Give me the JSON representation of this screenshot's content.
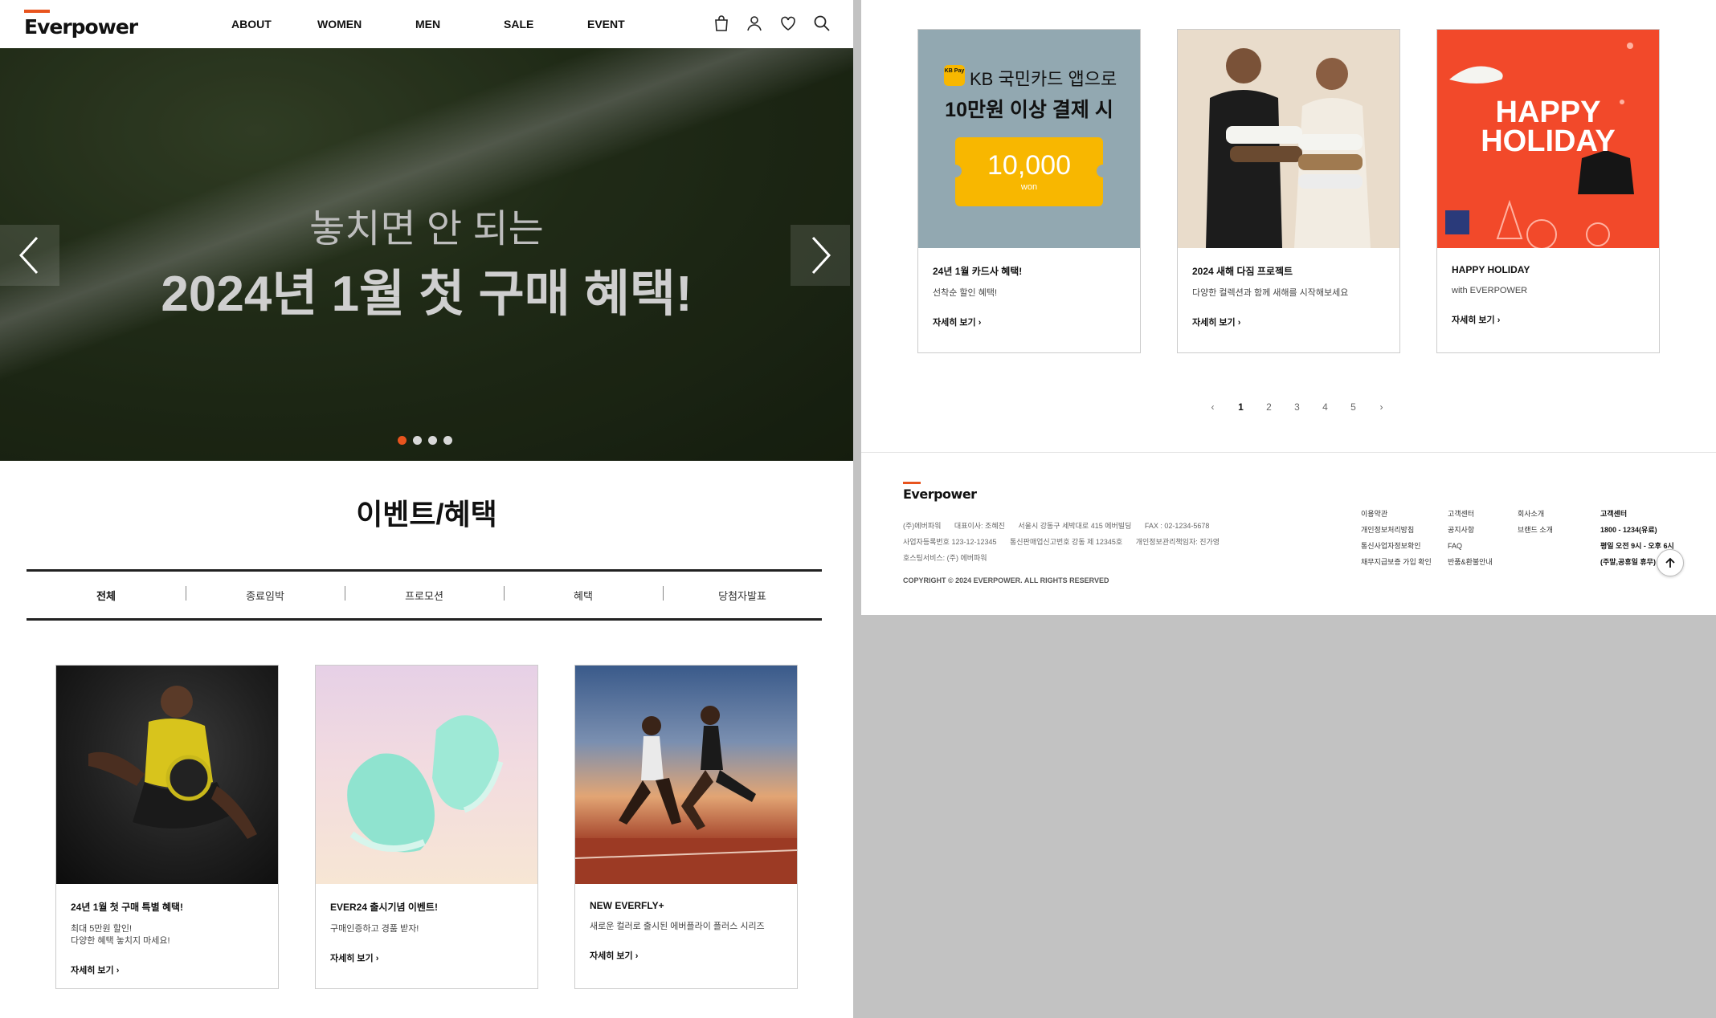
{
  "brand": "Everpower",
  "colors": {
    "accent": "#e8541e",
    "kb_yellow": "#f8b700",
    "holiday_orange": "#f2492a",
    "kb_bg": "#92a8b1"
  },
  "nav": [
    "ABOUT",
    "WOMEN",
    "MEN",
    "SALE",
    "EVENT"
  ],
  "header_icons": [
    "shopping-bag-icon",
    "user-icon",
    "heart-icon",
    "search-icon"
  ],
  "hero": {
    "subtitle": "놓치면 안 되는",
    "title": "2024년 1월 첫 구매 혜택!",
    "slides": 4,
    "active_slide": 1
  },
  "section_title": "이벤트/혜택",
  "tabs": [
    "전체",
    "종료임박",
    "프로모션",
    "혜택",
    "당첨자발표"
  ],
  "active_tab": "전체",
  "cards_left": [
    {
      "title": "24년 1월 첫 구매 특별 혜택!",
      "desc": "최대 5만원 할인!\n다양한 혜택 놓치지 마세요!",
      "more": "자세히 보기"
    },
    {
      "title": "EVER24 출시기념 이벤트!",
      "desc": "구매인증하고 경품 받자!",
      "more": "자세히 보기"
    },
    {
      "title": "NEW EVERFLY+",
      "desc": "새로운 컬러로 출시된 에버플라이 플러스 시리즈",
      "more": "자세히 보기"
    }
  ],
  "cards_right": [
    {
      "title": "24년 1월 카드사 혜택!",
      "desc": "선착순 할인 혜택!",
      "more": "자세히 보기"
    },
    {
      "title": "2024 새해 다짐 프로젝트",
      "desc": "다양한 컬렉션과 함께 새해를 시작해보세요",
      "more": "자세히 보기"
    },
    {
      "title": "HAPPY HOLIDAY",
      "desc": "with EVERPOWER",
      "more": "자세히 보기"
    }
  ],
  "kb_banner": {
    "pay_badge": "KB Pay",
    "line1": "KB 국민카드 앱으로",
    "line2": "10만원 이상 결제 시",
    "amount": "10,000",
    "unit": "won"
  },
  "holiday_banner": {
    "line1": "HAPPY",
    "line2": "HOLIDAY"
  },
  "pagination": {
    "pages": [
      "1",
      "2",
      "3",
      "4",
      "5"
    ],
    "current": "1"
  },
  "footer": {
    "info_rows": [
      [
        "(주)에버파워",
        "대표이사: 조혜진",
        "서울시 강동구 세박대로 415 에버빌딩",
        "FAX : 02-1234-5678"
      ],
      [
        "사업자등록번호 123-12-12345",
        "통신판매업신고번호 강동 제 12345호",
        "개인정보관리책임자: 진가영"
      ],
      [
        "호스팅서비스: (주) 에버파워"
      ]
    ],
    "copyright": "COPYRIGHT © 2024 EVERPOWER. ALL RIGHTS RESERVED",
    "col1": [
      "이용약관",
      "개인정보처리방침",
      "통신사업자정보확인",
      "채무지급보증 가입 확인"
    ],
    "col2": [
      "고객센터",
      "공지사항",
      "FAQ",
      "반품&환불안내"
    ],
    "col3": [
      "회사소개",
      "브랜드 소개"
    ],
    "col4": [
      "고객센터",
      "1800 - 1234(유료)",
      "평일 오전 9시 - 오후 6시",
      "(주말,공휴일 휴무)"
    ]
  }
}
